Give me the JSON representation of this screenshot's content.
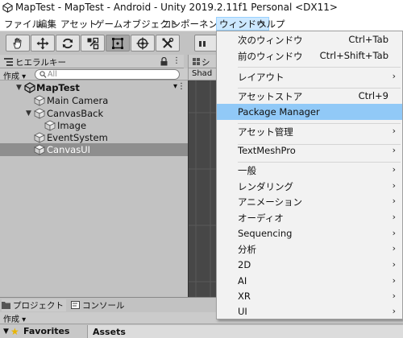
{
  "window": {
    "title": "MapTest - MapTest - Android - Unity 2019.2.11f1 Personal <DX11>"
  },
  "menubar": {
    "items": [
      {
        "label": "ファイル"
      },
      {
        "label": "編集"
      },
      {
        "label": "アセット"
      },
      {
        "label": "ゲームオブジェクト"
      },
      {
        "label": "コンポーネント"
      },
      {
        "label": "ウィンドウ"
      },
      {
        "label": "ヘルプ"
      }
    ],
    "active_index": 5
  },
  "toolbar": {
    "tools": [
      {
        "icon": "hand-tool-icon"
      },
      {
        "icon": "move-tool-icon"
      },
      {
        "icon": "rotate-tool-icon"
      },
      {
        "icon": "scale-tool-icon"
      },
      {
        "icon": "rect-tool-icon"
      },
      {
        "icon": "transform-tool-icon"
      },
      {
        "icon": "custom-tool-icon"
      }
    ],
    "active_tool_index": 4
  },
  "hierarchy": {
    "tab_label": "ヒエラルキー",
    "create_label": "作成 ▾",
    "search_placeholder": "All",
    "scene_name": "MapTest",
    "items": [
      {
        "label": "Main Camera",
        "depth": 1,
        "expandable": false,
        "selected": false
      },
      {
        "label": "CanvasBack",
        "depth": 1,
        "expandable": true,
        "selected": false
      },
      {
        "label": "Image",
        "depth": 2,
        "expandable": false,
        "selected": false
      },
      {
        "label": "EventSystem",
        "depth": 1,
        "expandable": false,
        "selected": false
      },
      {
        "label": "CanvasUI",
        "depth": 1,
        "expandable": false,
        "selected": true
      }
    ]
  },
  "scene": {
    "tab_label": "シ",
    "shading_label": "Shad"
  },
  "bottom": {
    "project_tab": "プロジェクト",
    "console_tab": "コンソール",
    "create_label": "作成 ▾",
    "favorites_label": "Favorites",
    "assets_label": "Assets"
  },
  "window_menu": {
    "items": [
      {
        "label": "次のウィンドウ",
        "shortcut": "Ctrl+Tab",
        "submenu": false,
        "highlight": false
      },
      {
        "label": "前のウィンドウ",
        "shortcut": "Ctrl+Shift+Tab",
        "submenu": false,
        "highlight": false
      },
      {
        "separator": true
      },
      {
        "label": "レイアウト",
        "shortcut": "",
        "submenu": true,
        "highlight": false
      },
      {
        "separator": true
      },
      {
        "label": "アセットストア",
        "shortcut": "Ctrl+9",
        "submenu": false,
        "highlight": false
      },
      {
        "label": "Package Manager",
        "shortcut": "",
        "submenu": false,
        "highlight": true
      },
      {
        "separator": true
      },
      {
        "label": "アセット管理",
        "shortcut": "",
        "submenu": true,
        "highlight": false
      },
      {
        "separator": true
      },
      {
        "label": "TextMeshPro",
        "shortcut": "",
        "submenu": true,
        "highlight": false
      },
      {
        "separator": true
      },
      {
        "label": "一般",
        "shortcut": "",
        "submenu": true,
        "highlight": false
      },
      {
        "label": "レンダリング",
        "shortcut": "",
        "submenu": true,
        "highlight": false
      },
      {
        "label": "アニメーション",
        "shortcut": "",
        "submenu": true,
        "highlight": false
      },
      {
        "label": "オーディオ",
        "shortcut": "",
        "submenu": true,
        "highlight": false
      },
      {
        "label": "Sequencing",
        "shortcut": "",
        "submenu": true,
        "highlight": false
      },
      {
        "label": "分析",
        "shortcut": "",
        "submenu": true,
        "highlight": false
      },
      {
        "label": "2D",
        "shortcut": "",
        "submenu": true,
        "highlight": false
      },
      {
        "label": "AI",
        "shortcut": "",
        "submenu": true,
        "highlight": false
      },
      {
        "label": "XR",
        "shortcut": "",
        "submenu": true,
        "highlight": false
      },
      {
        "label": "UI",
        "shortcut": "",
        "submenu": true,
        "highlight": false
      }
    ]
  },
  "colors": {
    "menu_highlight": "#91c9f7",
    "active_menubar": "#cce8ff",
    "selected_row": "#8e8e8e",
    "editor_gray": "#c2c2c2"
  }
}
